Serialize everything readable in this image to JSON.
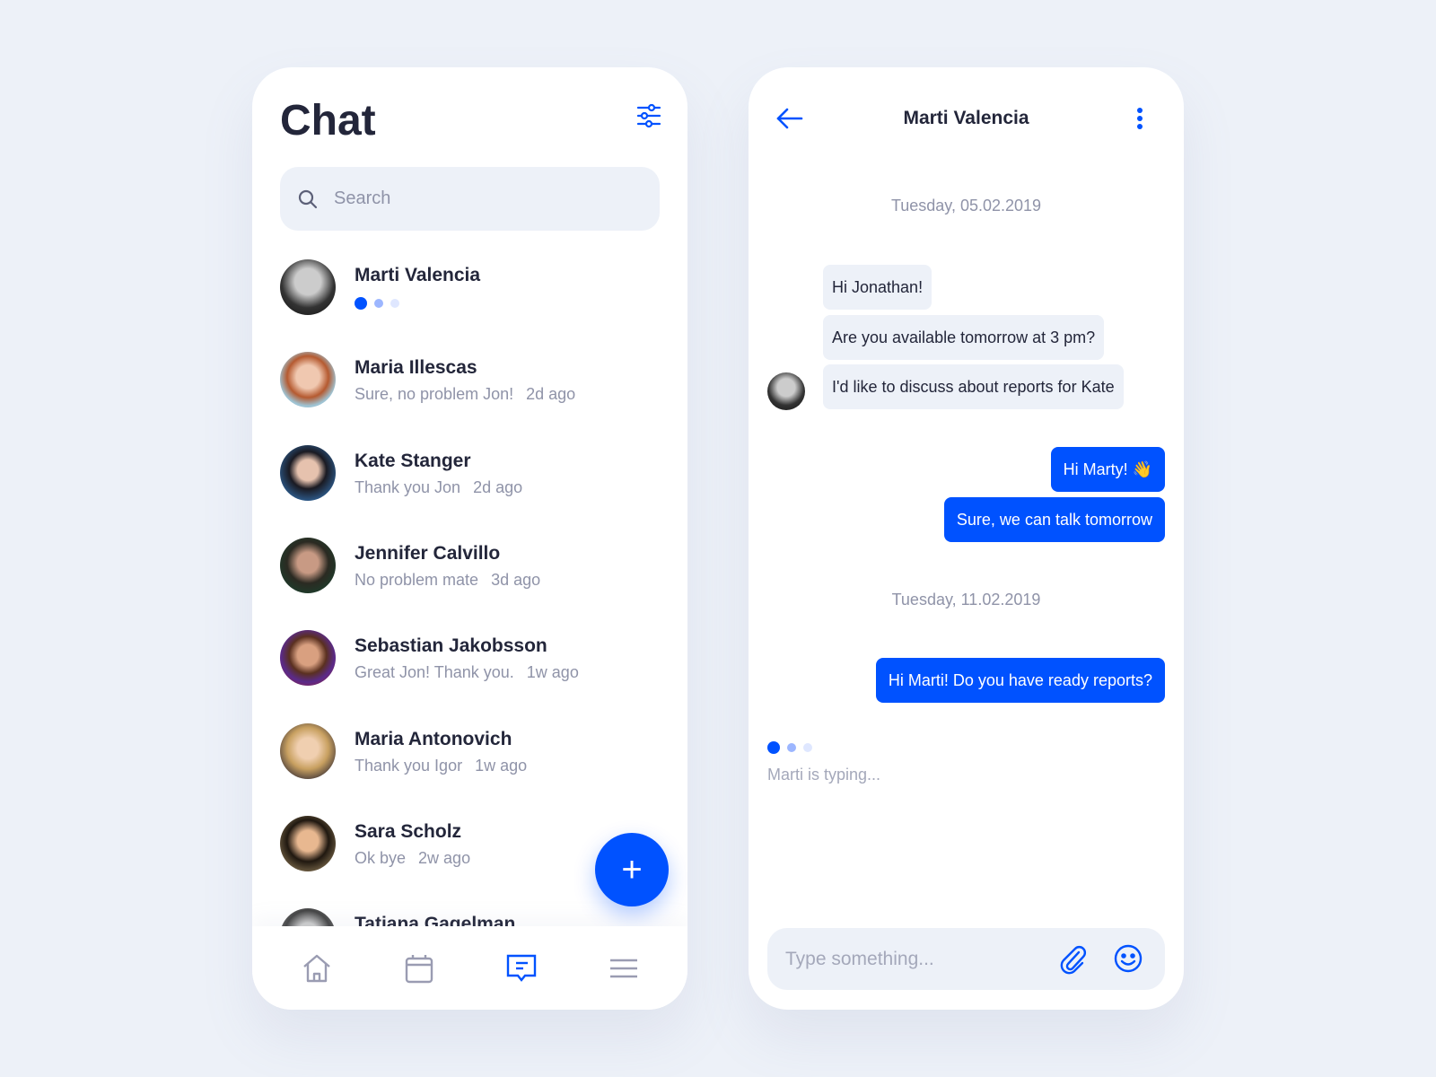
{
  "list": {
    "title": "Chat",
    "search_placeholder": "Search",
    "contacts": [
      {
        "name": "Marti Valencia",
        "typing": true
      },
      {
        "name": "Maria Illescas",
        "message": "Sure, no problem Jon!",
        "time": "2d ago"
      },
      {
        "name": "Kate Stanger",
        "message": "Thank you Jon",
        "time": "2d ago"
      },
      {
        "name": "Jennifer Calvillo",
        "message": "No problem mate",
        "time": "3d ago"
      },
      {
        "name": "Sebastian Jakobsson",
        "message": "Great Jon! Thank you.",
        "time": "1w ago"
      },
      {
        "name": "Maria Antonovich",
        "message": "Thank you Igor",
        "time": "1w ago"
      },
      {
        "name": "Sara Scholz",
        "message": "Ok bye",
        "time": "2w ago"
      },
      {
        "name": "Tatiana Gagelman"
      }
    ],
    "fab_label": "+",
    "nav": [
      "home-icon",
      "calendar-icon",
      "chat-icon",
      "menu-icon"
    ],
    "active_nav": "chat-icon"
  },
  "conversation": {
    "title": "Marti Valencia",
    "dates": [
      "Tuesday, 05.02.2019",
      "Tuesday, 11.02.2019"
    ],
    "messages": [
      {
        "from": "Marti",
        "text": "Hi Jonathan!"
      },
      {
        "from": "Marti",
        "text": "Are you available tomorrow at 3 pm?"
      },
      {
        "from": "Marti",
        "text": "I'd like to discuss about reports for Kate"
      },
      {
        "from": "me",
        "text": "Hi Marty! 👋"
      },
      {
        "from": "me",
        "text": "Sure, we can talk tomorrow"
      },
      {
        "from": "me",
        "text": "Hi Marti! Do you have ready reports?"
      }
    ],
    "typing_text": "Marti is typing...",
    "input_placeholder": "Type something..."
  },
  "colors": {
    "accent": "#0052ff",
    "background": "#edf1f8",
    "text": "#23263a",
    "muted": "#8f93a8"
  }
}
